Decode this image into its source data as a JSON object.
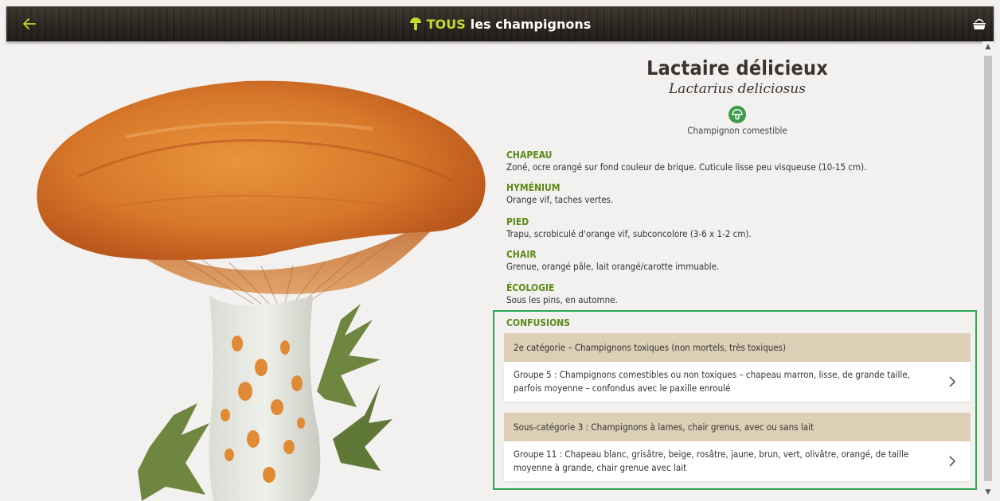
{
  "topbar": {
    "title_accent": "TOUS",
    "title_rest": "les champignons",
    "accent_color": "#c5d92c"
  },
  "species": {
    "common_name": "Lactaire délicieux",
    "latin_name": "Lactarius deliciosus",
    "edibility": "Champignon comestible",
    "edible_icon": "mushroom-icon",
    "edible_color": "#3e9b49"
  },
  "sections": [
    {
      "title": "CHAPEAU",
      "text": "Zoné, ocre orangé sur fond couleur de brique. Cuticule lisse peu visqueuse (10-15 cm)."
    },
    {
      "title": "HYMÉNIUM",
      "text": "Orange vif, taches vertes."
    },
    {
      "title": "PIED",
      "text": "Trapu, scrobiculé d'orange vif, subconcolore (3-6 x 1-2 cm)."
    },
    {
      "title": "CHAIR",
      "text": "Grenue, orangé pâle, lait orangé/carotte immuable."
    },
    {
      "title": "ÉCOLOGIE",
      "text": "Sous les pins, en automne."
    }
  ],
  "confusions": {
    "title": "CONFUSIONS",
    "categories": [
      {
        "header": "2e catégorie – Champignons toxiques (non mortels, très toxiques)",
        "group": "Groupe 5 : Champignons comestibles ou non toxiques – chapeau marron, lisse, de grande taille, parfois moyenne – confondus avec le paxille enroulé"
      },
      {
        "header": "Sous-catégorie 3 : Champignons à lames, chair grenus, avec ou sans lait",
        "group": "Groupe 11 : Chapeau blanc, grisâtre, beige, rosâtre, jaune, brun, vert, olivâtre, orangé, de taille moyenne à grande, chair grenue avec lait"
      }
    ],
    "border_color": "#2fa84f",
    "header_bg": "#dccfb6"
  },
  "section_title_color": "#5c8a17"
}
